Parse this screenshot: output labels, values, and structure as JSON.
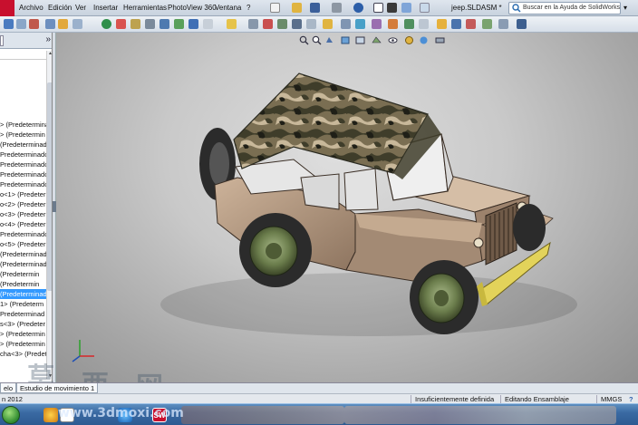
{
  "window": {
    "menu": [
      "Archivo",
      "Edición",
      "Ver",
      "Insertar",
      "Herramientas",
      "PhotoView 360",
      "Ventana",
      "?"
    ],
    "document_title": "jeep.SLDASM *",
    "help_search_placeholder": "Buscar en la Ayuda de SolidWorks",
    "help_search_caret": "▾",
    "brand_color": "#c8102e"
  },
  "left_panel": {
    "collapse_glyph": "»",
    "tree_items": [
      "> (Predetermina",
      "> (Predetermin",
      "(Predeterminad",
      "Predeterminado",
      "Predeterminado",
      "Predeterminado",
      "Predeterminado",
      "o<1> (Predeterm",
      "o<2> (Predeterm",
      "o<3> (Predeterm",
      "o<4> (Predeterm",
      "Predeterminado",
      "o<5> (Predeterm",
      "(Predeterminad",
      "(Predeterminado",
      "(Predetermin",
      "(Predetermin",
      "(Predeterminad",
      "1> (Predeterm",
      "Predeterminad",
      "s<3> (Predeter",
      "> (Predetermin",
      "> (Predetermin",
      "cha<3> (Predet"
    ],
    "selected_index": 17
  },
  "bottom_tabs": [
    "elo",
    "Estudio de movimiento 1"
  ],
  "status": {
    "left": "n 2012",
    "definition": "Insuficientemente definida",
    "mode": "Editando Ensamblaje",
    "units": "MMGS",
    "help_icon": "?"
  },
  "watermark": {
    "chars": [
      "莫",
      "西",
      "网"
    ],
    "url": "www.3dmoxi.com"
  },
  "model": {
    "name": "jeep",
    "body_color": "#b89c84",
    "tire_color": "#2b2b2b",
    "rim_color": "#6b7d4c",
    "bumper_color": "#e3d35a",
    "canopy_camo_colors": [
      "#3f3d2a",
      "#7a6e52",
      "#c8b89a",
      "#1f1f17"
    ]
  }
}
